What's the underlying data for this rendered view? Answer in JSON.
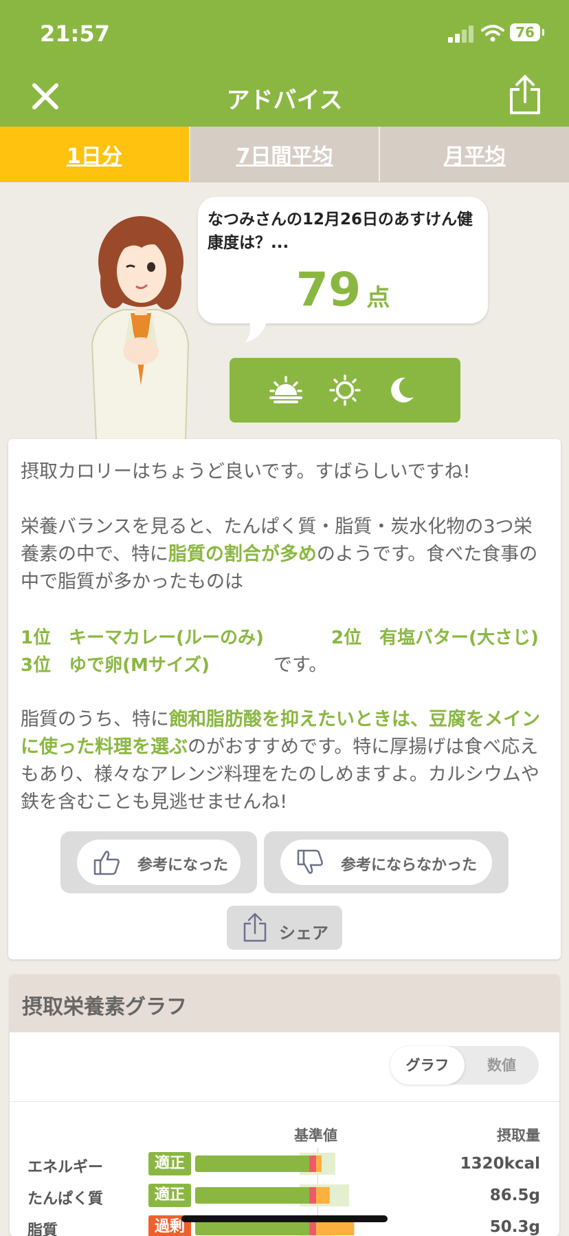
{
  "status_bar": {
    "time": "21:57",
    "battery": "76"
  },
  "nav": {
    "title": "アドバイス"
  },
  "tabs": [
    {
      "label": "1日分",
      "active": true
    },
    {
      "label": "7日間平均",
      "active": false
    },
    {
      "label": "月平均",
      "active": false
    }
  ],
  "speech": {
    "text": "なつみさんの12月26日のあすけん健康度は？...",
    "score": "79",
    "score_unit": "点"
  },
  "meal_icons": [
    "sunrise-icon",
    "sun-icon",
    "moon-icon"
  ],
  "advice": {
    "p1": "摂取カロリーはちょうど良いです。すばらしいですね!",
    "p2_a": "栄養バランスを見ると、たんぱく質・脂質・炭水化物の3つ栄養素の中で、特に",
    "p2_hl": "脂質の割合が多め",
    "p2_b": "のようです。食べた食事の中で脂質が多かったものは",
    "rank1": "1位　キーマカレー(ルーのみ)",
    "rank2": "2位　有塩バター(大さじ)",
    "rank3": "3位　ゆで卵(Mサイズ)",
    "rank_suffix": "です。",
    "p3_a": "脂質のうち、特に",
    "p3_hl": "飽和脂肪酸を抑えたいときは、豆腐をメインに使った料理を選ぶ",
    "p3_b": "のがおすすめです。特に厚揚げは食べ応えもあり、様々なアレンジ料理をたのしめますよ。カルシウムや鉄を含むことも見逃せませんね!"
  },
  "feedback": {
    "helpful": "参考になった",
    "not_helpful": "参考にならなかった",
    "share": "シェア"
  },
  "graph": {
    "title": "摂取栄養素グラフ",
    "toggle": [
      {
        "label": "グラフ",
        "active": true
      },
      {
        "label": "数値",
        "active": false
      }
    ],
    "col_reference": "基準値",
    "col_intake": "摂取量",
    "rows": [
      {
        "name": "エネルギー",
        "status": "適正",
        "status_color": "#8ab741",
        "value": "1320kcal",
        "level": 0.96
      },
      {
        "name": "たんぱく質",
        "status": "適正",
        "status_color": "#8ab741",
        "value": "86.5g",
        "level": 1.1
      },
      {
        "name": "脂質",
        "status": "過剰",
        "status_color": "#f0602c",
        "value": "50.3g",
        "level": 1.3
      }
    ]
  },
  "colors": {
    "brand_green": "#8ab741",
    "tab_active": "#ffc20e",
    "tab_inactive": "#d6cdc5",
    "excess": "#f0602c"
  }
}
